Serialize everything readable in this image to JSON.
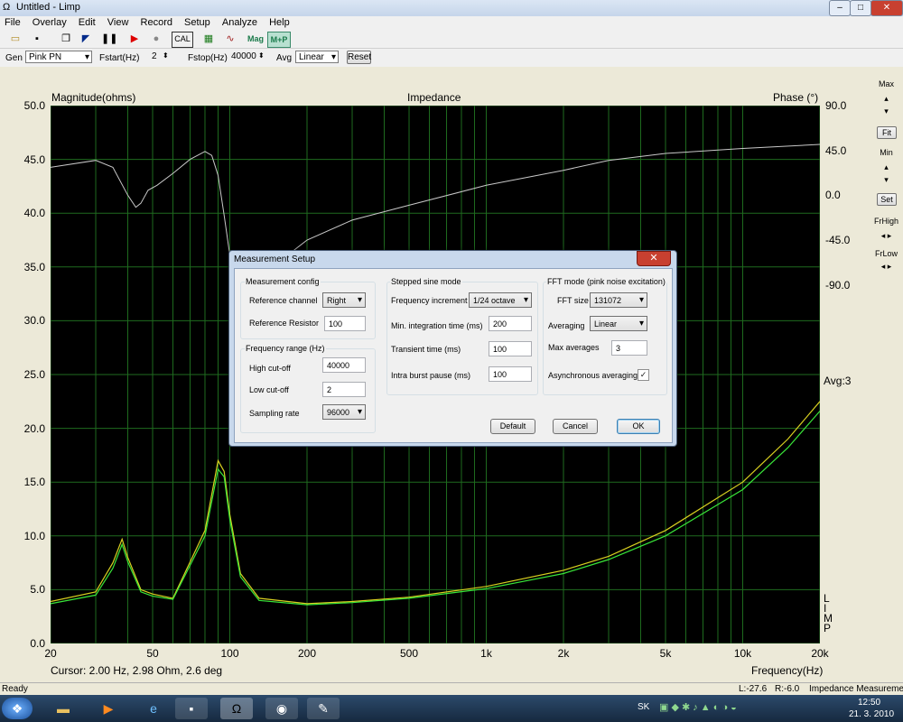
{
  "window": {
    "title": "Untitled - Limp",
    "minimize": "–",
    "maximize": "□",
    "close": "✕"
  },
  "menu": [
    "File",
    "Overlay",
    "Edit",
    "View",
    "Record",
    "Setup",
    "Analyze",
    "Help"
  ],
  "toolbar": {
    "cal": "CAL",
    "mag": "Mag",
    "mp": "M+P"
  },
  "genbar": {
    "gen_label": "Gen",
    "gen_value": "Pink PN",
    "fstart_label": "Fstart(Hz)",
    "fstart_value": "2",
    "fstop_label": "Fstop(Hz)",
    "fstop_value": "40000",
    "avg_label": "Avg",
    "avg_value": "Linear",
    "reset": "Reset"
  },
  "graph": {
    "title": "Impedance",
    "left_label": "Magnitude(ohms)",
    "right_label": "Phase (°)",
    "xlabel": "Frequency(Hz)",
    "cursor": "Cursor: 2.00 Hz, 2.98 Ohm, 2.6 deg",
    "avg": "Avg:3",
    "limp_letters": [
      "L",
      "I",
      "M",
      "P"
    ]
  },
  "side": {
    "max": "Max",
    "fit": "Fit",
    "min": "Min",
    "set": "Set",
    "frhigh": "FrHigh",
    "frlow": "FrLow"
  },
  "colors": {
    "plot_bg": "#000000",
    "grid": "#1f6b1f",
    "mag1": "#d8d020",
    "mag2": "#39e639",
    "phase": "#c8c8c8"
  },
  "chart_data": {
    "type": "line",
    "title": "Impedance",
    "xlabel": "Frequency(Hz)",
    "ylabel": "Magnitude(ohms)",
    "y2label": "Phase (°)",
    "xscale": "log",
    "xlim": [
      20,
      20000
    ],
    "ylim": [
      0,
      50
    ],
    "y2lim": [
      -180,
      90
    ],
    "grid": true,
    "x_ticks": [
      "20",
      "50",
      "100",
      "200",
      "500",
      "1k",
      "2k",
      "5k",
      "10k",
      "20k"
    ],
    "y_ticks": [
      "0.0",
      "5.0",
      "10.0",
      "15.0",
      "20.0",
      "25.0",
      "30.0",
      "35.0",
      "40.0",
      "45.0",
      "50.0"
    ],
    "y2_ticks": [
      "90.0",
      "45.0",
      "0.0",
      "-45.0",
      "-90.0"
    ],
    "series": [
      {
        "x": [
          20,
          30,
          35,
          38,
          40,
          45,
          50,
          60,
          80,
          90,
          95,
          100,
          110,
          130,
          200,
          300,
          500,
          1000,
          2000,
          3000,
          5000,
          10000,
          15000,
          20000
        ],
        "y": [
          3.9,
          4.8,
          7.5,
          9.7,
          8.0,
          5.0,
          4.6,
          4.2,
          10.5,
          17.0,
          16.0,
          12.0,
          6.5,
          4.2,
          3.7,
          3.9,
          4.3,
          5.3,
          6.8,
          8.1,
          10.5,
          15.0,
          19.0,
          22.5
        ]
      },
      {
        "x": [
          20,
          30,
          35,
          38,
          40,
          45,
          50,
          60,
          80,
          90,
          95,
          100,
          110,
          130,
          200,
          300,
          500,
          1000,
          2000,
          3000,
          5000,
          10000,
          15000,
          20000
        ],
        "y": [
          3.7,
          4.5,
          7.0,
          9.2,
          7.6,
          4.8,
          4.4,
          4.1,
          10.0,
          16.2,
          15.5,
          11.5,
          6.2,
          4.0,
          3.6,
          3.8,
          4.2,
          5.1,
          6.5,
          7.8,
          10.0,
          14.3,
          18.2,
          21.6
        ]
      },
      {
        "x": [
          20,
          30,
          35,
          40,
          43,
          45,
          48,
          52,
          60,
          70,
          80,
          85,
          90,
          95,
          100,
          110,
          130,
          150,
          200,
          300,
          500,
          1000,
          2000,
          3000,
          5000,
          10000,
          20000
        ],
        "y": [
          28,
          35,
          28,
          0,
          -12,
          -8,
          5,
          10,
          22,
          36,
          44,
          40,
          20,
          -20,
          -60,
          -80,
          -78,
          -70,
          -45,
          -25,
          -10,
          10,
          25,
          35,
          42,
          47,
          51
        ]
      }
    ]
  },
  "dialog": {
    "title": "Measurement Setup",
    "close": "✕",
    "g1_label": "Measurement config",
    "ref_channel_label": "Reference channel",
    "ref_channel_value": "Right",
    "ref_resistor_label": "Reference Resistor",
    "ref_resistor_value": "100",
    "g2_label": "Frequency range (Hz)",
    "high_label": "High cut-off",
    "high_value": "40000",
    "low_label": "Low cut-off",
    "low_value": "2",
    "sr_label": "Sampling rate",
    "sr_value": "96000",
    "g3_label": "Stepped sine mode",
    "fi_label": "Frequency increment",
    "fi_value": "1/24 octave",
    "mit_label": "Min. integration time (ms)",
    "mit_value": "200",
    "tt_label": "Transient time (ms)",
    "tt_value": "100",
    "ibp_label": "Intra burst pause (ms)",
    "ibp_value": "100",
    "g4_label": "FFT mode (pink noise excitation)",
    "fft_label": "FFT size",
    "fft_value": "131072",
    "avg_label": "Averaging",
    "avg_value": "Linear",
    "maxavg_label": "Max averages",
    "maxavg_value": "3",
    "async_label": "Asynchronous averaging",
    "async_checked": "✓",
    "default_btn": "Default",
    "cancel_btn": "Cancel",
    "ok_btn": "OK"
  },
  "status": {
    "ready": "Ready",
    "l": "L:-27.6",
    "r": "R:-6.0",
    "mode": "Impedance Measurement"
  },
  "taskbar": {
    "lang": "SK",
    "time": "12:50",
    "date": "21. 3. 2010"
  }
}
